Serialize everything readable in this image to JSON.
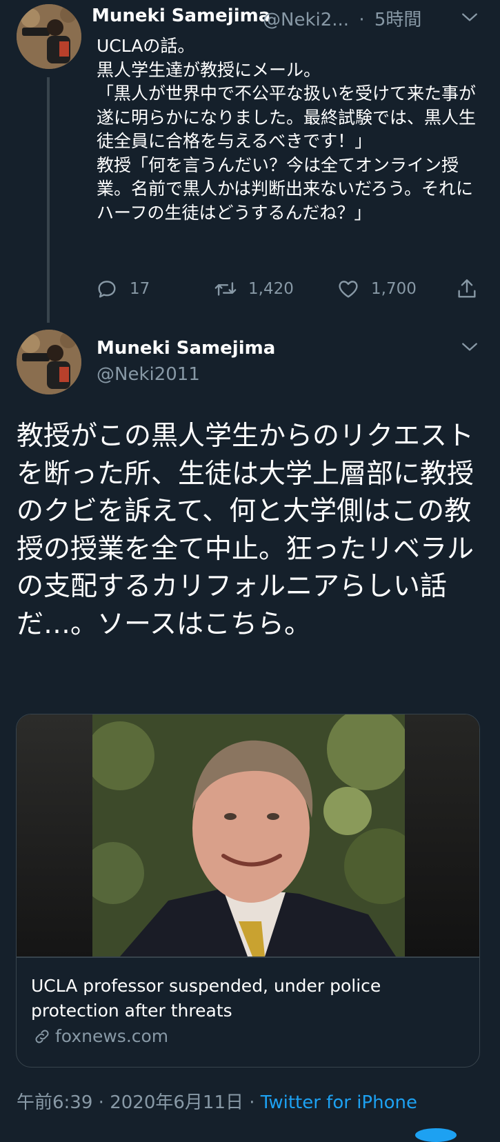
{
  "tweet1": {
    "name": "Muneki Samejima",
    "handle": "@Neki2...",
    "separator": "·",
    "time": "5時間",
    "text": "UCLAの話。\n黒人学生達が教授にメール。\n「黒人が世界中で不公平な扱いを受けて来た事が遂に明らかになりました。最終試験では、黒人生徒全員に合格を与えるべきです！」\n教授「何を言うんだい？今は全てオンライン授業。名前で黒人かは判断出来ないだろう。それにハーフの生徒はどうするんだね？」",
    "actions": {
      "reply_count": "17",
      "retweet_count": "1,420",
      "like_count": "1,700"
    }
  },
  "tweet2": {
    "name": "Muneki Samejima",
    "handle": "@Neki2011",
    "text": "教授がこの黒人学生からのリクエストを断った所、生徒は大学上層部に教授のクビを訴えて、何と大学側はこの教授の授業を全て中止。狂ったリベラルの支配するカリフォルニアらしい話だ…。ソースはこちら。",
    "card": {
      "title": "UCLA professor suspended, under police protection after threats",
      "domain": "foxnews.com"
    },
    "meta": {
      "time": "午前6:39",
      "dot1": " · ",
      "date": "2020年6月11日",
      "dot2": " · ",
      "source": "Twitter for iPhone"
    }
  },
  "icons": {
    "reply": "reply-icon",
    "retweet": "retweet-icon",
    "like": "heart-icon",
    "share": "share-icon",
    "more": "chevron-down-icon",
    "link": "link-icon"
  },
  "colors": {
    "background": "#15202b",
    "secondary_text": "#8899a6",
    "accent": "#1da1f2",
    "border": "#38444d"
  }
}
